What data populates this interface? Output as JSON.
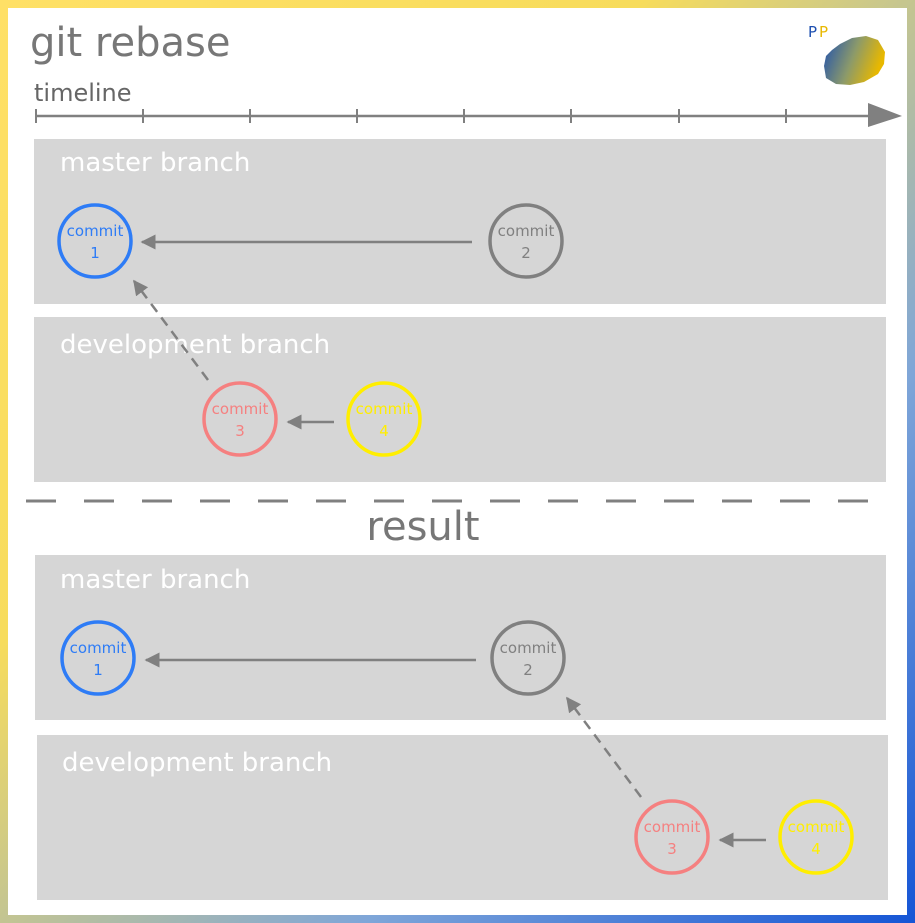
{
  "title": "git rebase",
  "logo": {
    "letter1": "P",
    "letter2": "P"
  },
  "timeline": {
    "label": "timeline"
  },
  "result_label": "result",
  "colors": {
    "blue": "#2e7cf6",
    "gray": "#808080",
    "salmon": "#f58080",
    "yellow": "#ffee00",
    "lane": "#d6d6d6",
    "arrow": "#808080"
  },
  "before": {
    "master": {
      "label": "master branch",
      "commits": [
        {
          "word": "commit",
          "num": "1",
          "color": "blue"
        },
        {
          "word": "commit",
          "num": "2",
          "color": "gray"
        }
      ]
    },
    "development": {
      "label": "development branch",
      "commits": [
        {
          "word": "commit",
          "num": "3",
          "color": "salmon"
        },
        {
          "word": "commit",
          "num": "4",
          "color": "yellow"
        }
      ]
    }
  },
  "after": {
    "master": {
      "label": "master branch",
      "commits": [
        {
          "word": "commit",
          "num": "1",
          "color": "blue"
        },
        {
          "word": "commit",
          "num": "2",
          "color": "gray"
        }
      ]
    },
    "development": {
      "label": "development branch",
      "commits": [
        {
          "word": "commit",
          "num": "3",
          "color": "salmon"
        },
        {
          "word": "commit",
          "num": "4",
          "color": "yellow"
        }
      ]
    }
  }
}
